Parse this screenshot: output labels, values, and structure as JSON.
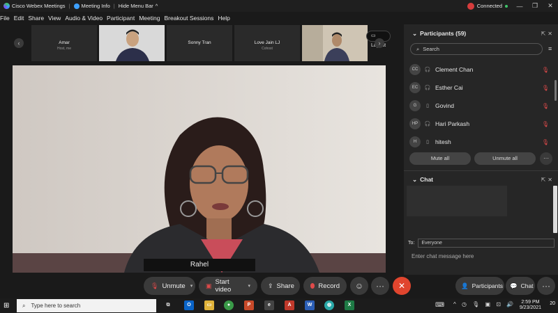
{
  "titlebar": {
    "app_name": "Cisco Webex Meetings",
    "meeting_info": "Meeting Info",
    "hide_menu": "Hide Menu Bar",
    "status": "Connected"
  },
  "menu": [
    "File",
    "Edit",
    "Share",
    "View",
    "Audio & Video",
    "Participant",
    "Meeting",
    "Breakout Sessions",
    "Help"
  ],
  "thumbnails": [
    {
      "name": "Amar",
      "role": "Host, me"
    },
    {
      "name": "",
      "role": ""
    },
    {
      "name": "Sonny Tran",
      "role": ""
    },
    {
      "name": "Love Jain LJ",
      "role": "Cohost"
    },
    {
      "name": "",
      "role": ""
    }
  ],
  "layout_label": "Layout",
  "main_speaker": "Rahel",
  "controls": {
    "unmute": "Unmute",
    "start_video": "Start video",
    "share": "Share",
    "record": "Record",
    "participants": "Participants",
    "chat": "Chat"
  },
  "participants_panel": {
    "title": "Participants (59)",
    "search_placeholder": "Search",
    "people": [
      {
        "initials": "CC",
        "name": "Clement Chan"
      },
      {
        "initials": "EC",
        "name": "Esther Cai"
      },
      {
        "initials": "G",
        "name": "Govind"
      },
      {
        "initials": "HP",
        "name": "Hari Parkash"
      },
      {
        "initials": "H",
        "name": "hitesh"
      }
    ],
    "mute_all": "Mute all",
    "unmute_all": "Unmute all"
  },
  "chat_panel": {
    "title": "Chat",
    "to_label": "To:",
    "to_value": "Everyone",
    "input_placeholder": "Enter chat message here"
  },
  "taskbar": {
    "search_placeholder": "Type here to search",
    "time": "2:59 PM",
    "date": "9/23/2021",
    "notif_count": "20"
  },
  "colors": {
    "end_call": "#e0452e",
    "accent": "#3da0ff",
    "mute_red": "#e04a4a"
  }
}
